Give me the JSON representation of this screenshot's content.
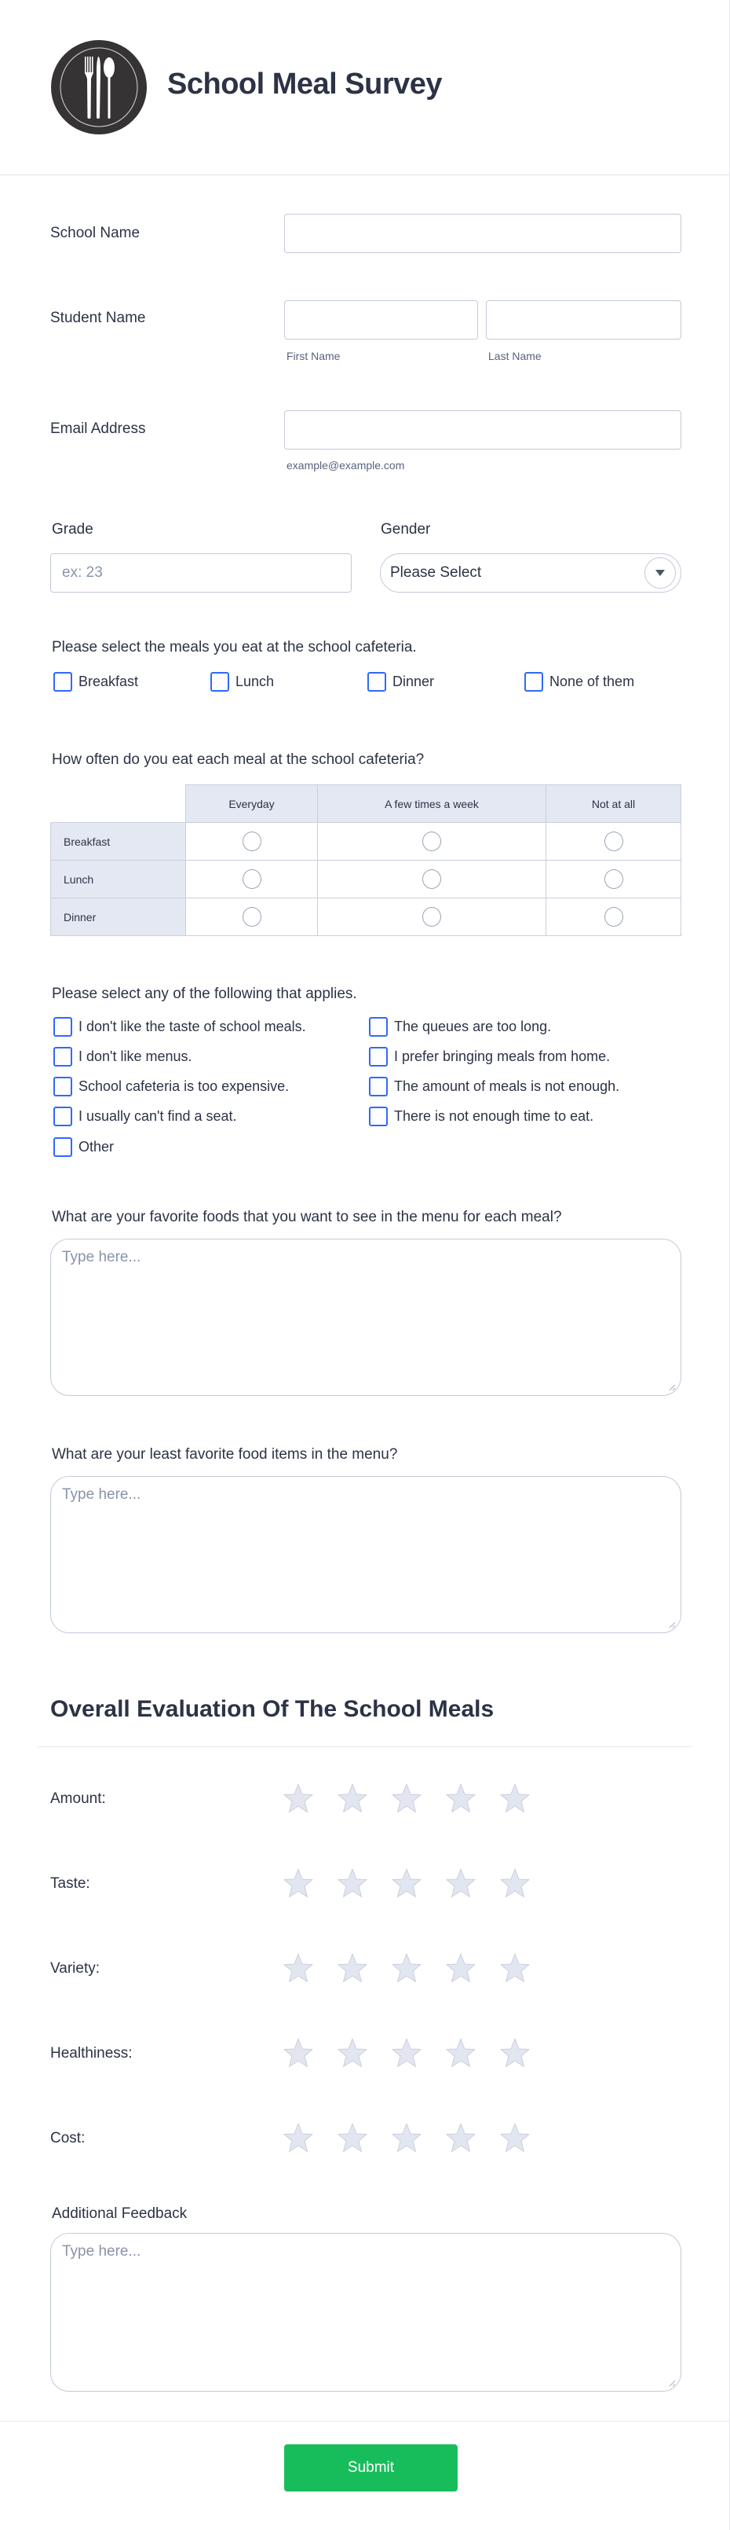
{
  "header": {
    "title": "School Meal Survey",
    "logo_icon": "plate-cutlery-icon"
  },
  "fields": {
    "school_name": {
      "label": "School Name",
      "value": ""
    },
    "student_name": {
      "label": "Student Name",
      "first": {
        "value": "",
        "sublabel": "First Name"
      },
      "last": {
        "value": "",
        "sublabel": "Last Name"
      }
    },
    "email": {
      "label": "Email Address",
      "value": "",
      "sublabel": "example@example.com"
    },
    "grade": {
      "label": "Grade",
      "value": "",
      "placeholder": "ex: 23"
    },
    "gender": {
      "label": "Gender",
      "selected": "Please Select"
    }
  },
  "meals": {
    "question": "Please select the meals you eat at the school cafeteria.",
    "options": [
      "Breakfast",
      "Lunch",
      "Dinner",
      "None of them"
    ]
  },
  "frequency": {
    "question": "How often do you eat each meal at the school cafeteria?",
    "columns": [
      "Everyday",
      "A few times a week",
      "Not at all"
    ],
    "rows": [
      "Breakfast",
      "Lunch",
      "Dinner"
    ]
  },
  "applies": {
    "question": "Please select any of the following that applies.",
    "options": [
      "I don't like the taste of school meals.",
      "The queues are too long.",
      "I don't like menus.",
      "I prefer bringing meals from home.",
      "School cafeteria is too expensive.",
      "The amount of meals is not enough.",
      "I usually can't find a seat.",
      "There is not enough time to eat.",
      "Other"
    ]
  },
  "favorite_foods": {
    "question": "What are your favorite foods that you want to see in the menu for each meal?",
    "placeholder": "Type here..."
  },
  "least_favorite": {
    "question": "What are your least favorite food items in the menu?",
    "placeholder": "Type here..."
  },
  "evaluation": {
    "title": "Overall Evaluation Of The School Meals",
    "ratings": [
      {
        "label": "Amount:",
        "value": 0,
        "max": 5
      },
      {
        "label": "Taste:",
        "value": 0,
        "max": 5
      },
      {
        "label": "Variety:",
        "value": 0,
        "max": 5
      },
      {
        "label": "Healthiness:",
        "value": 0,
        "max": 5
      },
      {
        "label": "Cost:",
        "value": 0,
        "max": 5
      }
    ]
  },
  "feedback": {
    "label": "Additional Feedback",
    "placeholder": "Type here..."
  },
  "submit": {
    "label": "Submit"
  },
  "colors": {
    "accent_checkbox": "#2e69ff",
    "submit_bg": "#18bd5b",
    "star_fill": "#e2e6f0",
    "text": "#2c3345"
  }
}
